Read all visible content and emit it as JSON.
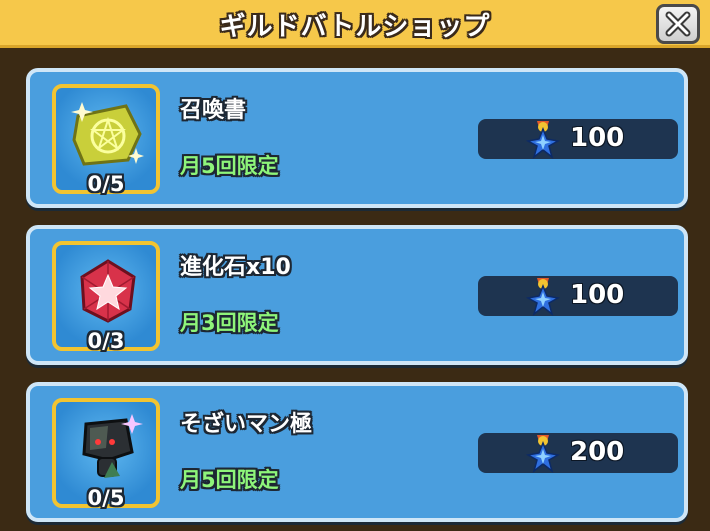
{
  "header": {
    "title": "ギルドバトルショップ",
    "close_icon": "close-icon"
  },
  "currency_icon": "guild-medal-icon",
  "items": [
    {
      "name": "召喚書",
      "limit": "月5回限定",
      "stock": "0/5",
      "price": "100",
      "icon": "summon-scroll-icon"
    },
    {
      "name": "進化石x10",
      "limit": "月3回限定",
      "stock": "0/3",
      "price": "100",
      "icon": "evolution-stone-icon"
    },
    {
      "name": "そざいマン極",
      "limit": "月5回限定",
      "stock": "0/5",
      "price": "200",
      "icon": "material-man-icon"
    }
  ],
  "colors": {
    "header": "#f6c84a",
    "card": "#4a9ede",
    "frame": "#f2c431",
    "limit_text": "#8ef57a",
    "price_bg": "#1e3450"
  }
}
